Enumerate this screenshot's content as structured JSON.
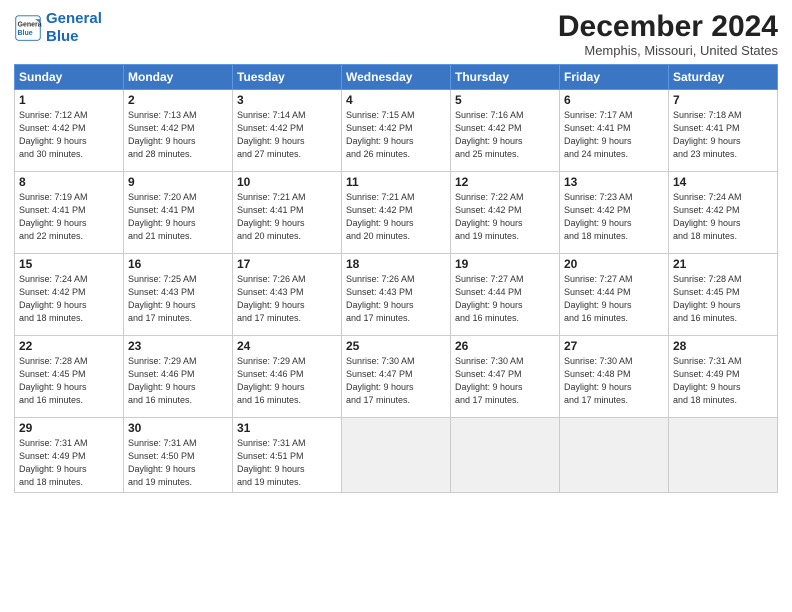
{
  "header": {
    "logo_line1": "General",
    "logo_line2": "Blue",
    "month": "December 2024",
    "location": "Memphis, Missouri, United States"
  },
  "days_of_week": [
    "Sunday",
    "Monday",
    "Tuesday",
    "Wednesday",
    "Thursday",
    "Friday",
    "Saturday"
  ],
  "weeks": [
    [
      {
        "day": "1",
        "info": "Sunrise: 7:12 AM\nSunset: 4:42 PM\nDaylight: 9 hours\nand 30 minutes."
      },
      {
        "day": "2",
        "info": "Sunrise: 7:13 AM\nSunset: 4:42 PM\nDaylight: 9 hours\nand 28 minutes."
      },
      {
        "day": "3",
        "info": "Sunrise: 7:14 AM\nSunset: 4:42 PM\nDaylight: 9 hours\nand 27 minutes."
      },
      {
        "day": "4",
        "info": "Sunrise: 7:15 AM\nSunset: 4:42 PM\nDaylight: 9 hours\nand 26 minutes."
      },
      {
        "day": "5",
        "info": "Sunrise: 7:16 AM\nSunset: 4:42 PM\nDaylight: 9 hours\nand 25 minutes."
      },
      {
        "day": "6",
        "info": "Sunrise: 7:17 AM\nSunset: 4:41 PM\nDaylight: 9 hours\nand 24 minutes."
      },
      {
        "day": "7",
        "info": "Sunrise: 7:18 AM\nSunset: 4:41 PM\nDaylight: 9 hours\nand 23 minutes."
      }
    ],
    [
      {
        "day": "8",
        "info": "Sunrise: 7:19 AM\nSunset: 4:41 PM\nDaylight: 9 hours\nand 22 minutes."
      },
      {
        "day": "9",
        "info": "Sunrise: 7:20 AM\nSunset: 4:41 PM\nDaylight: 9 hours\nand 21 minutes."
      },
      {
        "day": "10",
        "info": "Sunrise: 7:21 AM\nSunset: 4:41 PM\nDaylight: 9 hours\nand 20 minutes."
      },
      {
        "day": "11",
        "info": "Sunrise: 7:21 AM\nSunset: 4:42 PM\nDaylight: 9 hours\nand 20 minutes."
      },
      {
        "day": "12",
        "info": "Sunrise: 7:22 AM\nSunset: 4:42 PM\nDaylight: 9 hours\nand 19 minutes."
      },
      {
        "day": "13",
        "info": "Sunrise: 7:23 AM\nSunset: 4:42 PM\nDaylight: 9 hours\nand 18 minutes."
      },
      {
        "day": "14",
        "info": "Sunrise: 7:24 AM\nSunset: 4:42 PM\nDaylight: 9 hours\nand 18 minutes."
      }
    ],
    [
      {
        "day": "15",
        "info": "Sunrise: 7:24 AM\nSunset: 4:42 PM\nDaylight: 9 hours\nand 18 minutes."
      },
      {
        "day": "16",
        "info": "Sunrise: 7:25 AM\nSunset: 4:43 PM\nDaylight: 9 hours\nand 17 minutes."
      },
      {
        "day": "17",
        "info": "Sunrise: 7:26 AM\nSunset: 4:43 PM\nDaylight: 9 hours\nand 17 minutes."
      },
      {
        "day": "18",
        "info": "Sunrise: 7:26 AM\nSunset: 4:43 PM\nDaylight: 9 hours\nand 17 minutes."
      },
      {
        "day": "19",
        "info": "Sunrise: 7:27 AM\nSunset: 4:44 PM\nDaylight: 9 hours\nand 16 minutes."
      },
      {
        "day": "20",
        "info": "Sunrise: 7:27 AM\nSunset: 4:44 PM\nDaylight: 9 hours\nand 16 minutes."
      },
      {
        "day": "21",
        "info": "Sunrise: 7:28 AM\nSunset: 4:45 PM\nDaylight: 9 hours\nand 16 minutes."
      }
    ],
    [
      {
        "day": "22",
        "info": "Sunrise: 7:28 AM\nSunset: 4:45 PM\nDaylight: 9 hours\nand 16 minutes."
      },
      {
        "day": "23",
        "info": "Sunrise: 7:29 AM\nSunset: 4:46 PM\nDaylight: 9 hours\nand 16 minutes."
      },
      {
        "day": "24",
        "info": "Sunrise: 7:29 AM\nSunset: 4:46 PM\nDaylight: 9 hours\nand 16 minutes."
      },
      {
        "day": "25",
        "info": "Sunrise: 7:30 AM\nSunset: 4:47 PM\nDaylight: 9 hours\nand 17 minutes."
      },
      {
        "day": "26",
        "info": "Sunrise: 7:30 AM\nSunset: 4:47 PM\nDaylight: 9 hours\nand 17 minutes."
      },
      {
        "day": "27",
        "info": "Sunrise: 7:30 AM\nSunset: 4:48 PM\nDaylight: 9 hours\nand 17 minutes."
      },
      {
        "day": "28",
        "info": "Sunrise: 7:31 AM\nSunset: 4:49 PM\nDaylight: 9 hours\nand 18 minutes."
      }
    ],
    [
      {
        "day": "29",
        "info": "Sunrise: 7:31 AM\nSunset: 4:49 PM\nDaylight: 9 hours\nand 18 minutes."
      },
      {
        "day": "30",
        "info": "Sunrise: 7:31 AM\nSunset: 4:50 PM\nDaylight: 9 hours\nand 19 minutes."
      },
      {
        "day": "31",
        "info": "Sunrise: 7:31 AM\nSunset: 4:51 PM\nDaylight: 9 hours\nand 19 minutes."
      },
      null,
      null,
      null,
      null
    ]
  ]
}
